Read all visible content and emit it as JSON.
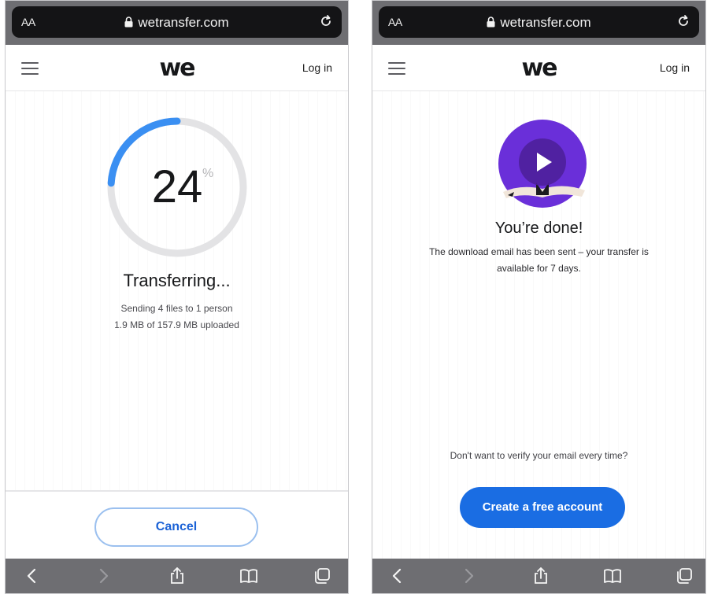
{
  "left_screen": {
    "browser": {
      "aa_label": "AA",
      "url": "wetransfer.com"
    },
    "header": {
      "logo": "we",
      "login_label": "Log in"
    },
    "progress": {
      "percent": "24",
      "percent_sign": "%",
      "fraction": 0.24
    },
    "status_title": "Transferring...",
    "detail_line1": "Sending 4 files to 1 person",
    "detail_line2": "1.9 MB of 157.9 MB uploaded",
    "cancel_label": "Cancel"
  },
  "right_screen": {
    "browser": {
      "aa_label": "AA",
      "url": "wetransfer.com"
    },
    "header": {
      "logo": "we",
      "login_label": "Log in"
    },
    "done_title": "You’re done!",
    "done_line1": "The download email has been sent – your transfer is",
    "done_line2": "available for 7 days.",
    "verify_question": "Don't want to verify your email every time?",
    "create_account_label": "Create a free account"
  },
  "colors": {
    "accent_blue": "#1a6de3",
    "progress_blue": "#3a8ff2",
    "thumbnail_purple": "#6a2fd9"
  },
  "icons": [
    "lock-icon",
    "reload-icon",
    "hamburger-icon",
    "play-icon",
    "back-icon",
    "forward-icon",
    "share-icon",
    "bookmarks-icon",
    "tabs-icon"
  ]
}
